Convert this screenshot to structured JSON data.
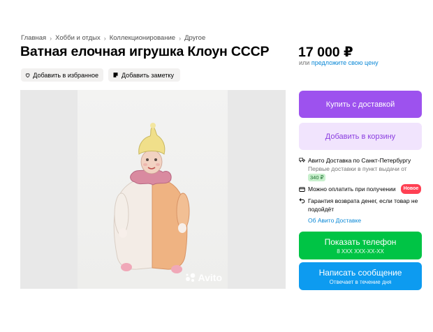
{
  "breadcrumb": {
    "items": [
      "Главная",
      "Хобби и отдых",
      "Коллекционирование",
      "Другое"
    ]
  },
  "title": "Ватная елочная игрушка Клоун СССР",
  "price": {
    "value": "17 000 ₽",
    "alt_prefix": "или",
    "alt_link": "предложите свою цену"
  },
  "actions": {
    "favorite": "Добавить в избранное",
    "note": "Добавить заметку"
  },
  "gallery": {
    "watermark": "Avito"
  },
  "buttons": {
    "buy": "Купить с доставкой",
    "cart": "Добавить в корзину",
    "phone": "Показать телефон",
    "phone_sub": "8 XXX XXX-XX-XX",
    "message": "Написать сообщение",
    "message_sub": "Отвечает в течение дня"
  },
  "delivery": {
    "title": "Авито Доставка по Санкт-Петербургу",
    "note": "Первые доставки в пункт выдачи от",
    "price_badge": "340 ₽",
    "pay_on_receipt": "Можно оплатить при получении",
    "new_badge": "Новое",
    "guarantee": "Гарантия возврата денег, если товар не подойдёт",
    "about_link": "Об Авито Доставке"
  },
  "colors": {
    "buy": "#9d52ee",
    "cart_bg": "#f1e4fd",
    "phone": "#00c445",
    "message": "#0d9bf0",
    "link": "#0a88d6",
    "new_badge": "#ff4053"
  }
}
